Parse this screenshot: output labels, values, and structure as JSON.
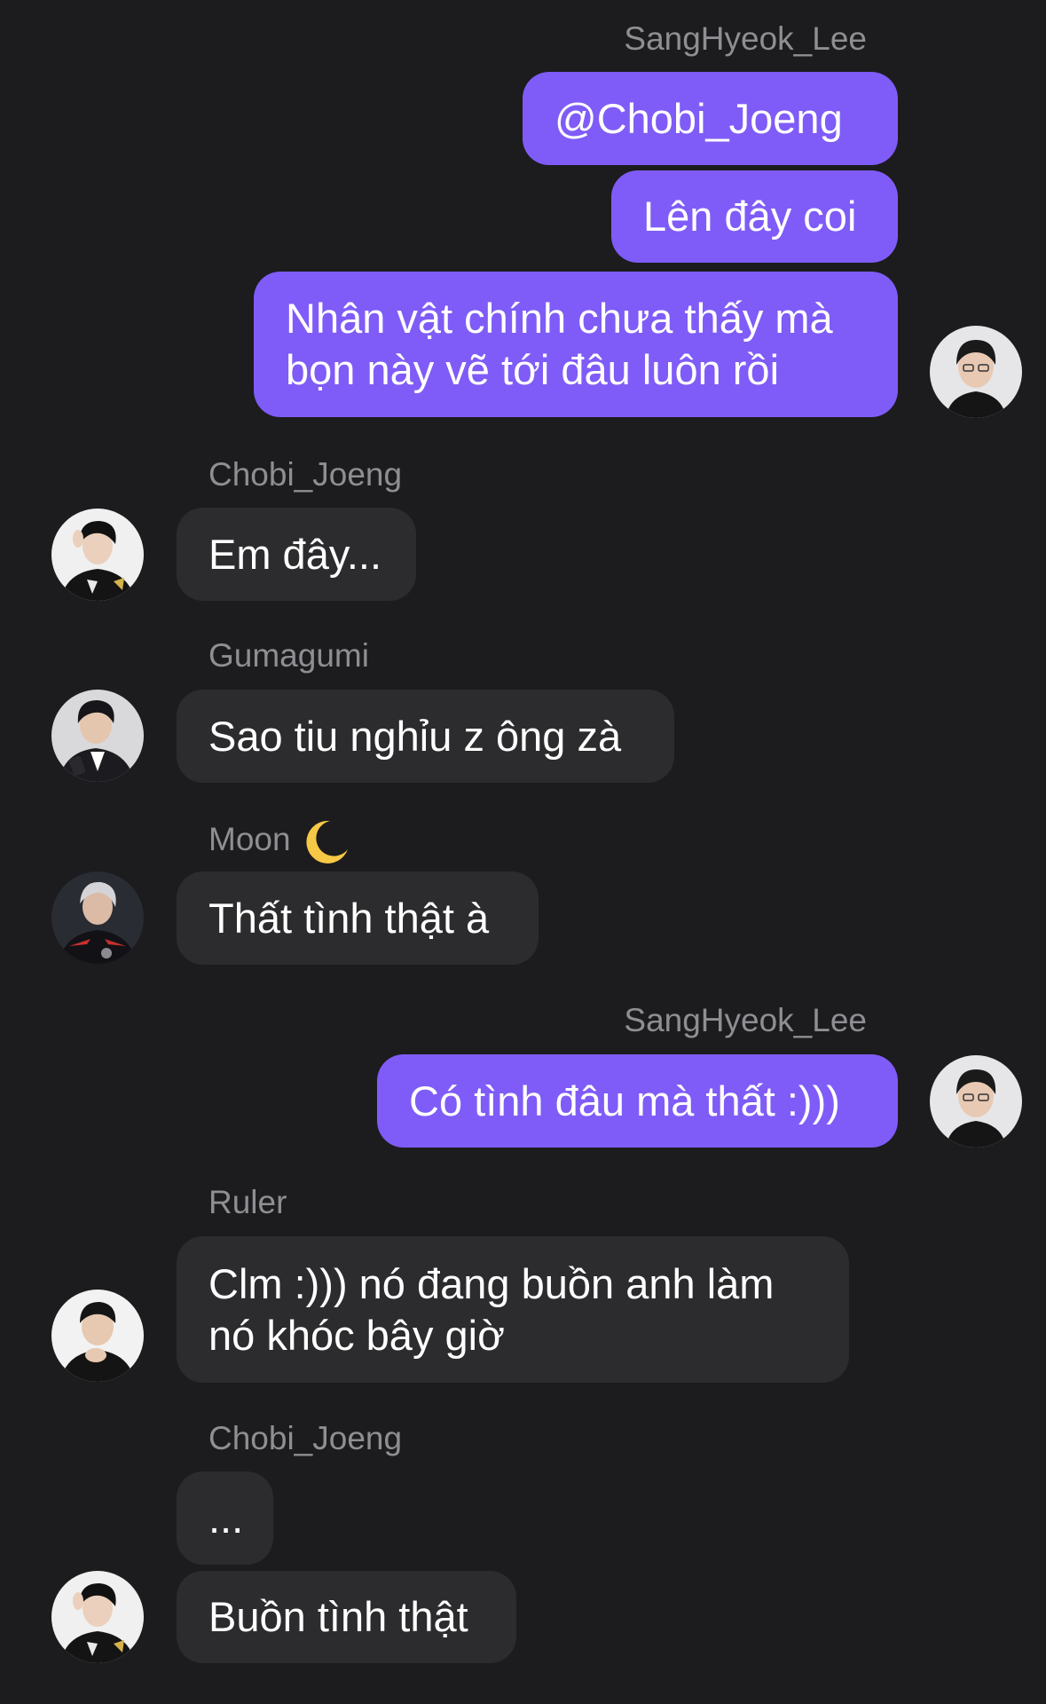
{
  "messages": [
    {
      "sender": "SangHyeok_Lee",
      "text": "@Chobi_Joeng"
    },
    {
      "text": "Lên đây coi"
    },
    {
      "text": "Nhân vật chính chưa thấy mà\nbọn này vẽ tới đâu luôn rồi"
    },
    {
      "sender": "Chobi_Joeng",
      "text": "Em đây..."
    },
    {
      "sender": "Gumagumi",
      "text": "Sao tiu nghỉu z ông zà"
    },
    {
      "sender": "Moon",
      "text": "Thất tình thật à"
    },
    {
      "sender": "SangHyeok_Lee",
      "text": "Có tình đâu mà thất :)))"
    },
    {
      "sender": "Ruler",
      "text": "Clm :))) nó đang buồn anh làm\nnó khóc bây giờ"
    },
    {
      "sender": "Chobi_Joeng",
      "text": "..."
    },
    {
      "text": "Buồn tình thật"
    }
  ],
  "colors": {
    "background": "#1c1c1e",
    "outgoing_bubble": "#7f5cf7",
    "incoming_bubble": "#2c2c2e",
    "sender_name": "#8e8e93"
  },
  "icons": {
    "moon_emoji": "crescent-moon-icon"
  }
}
